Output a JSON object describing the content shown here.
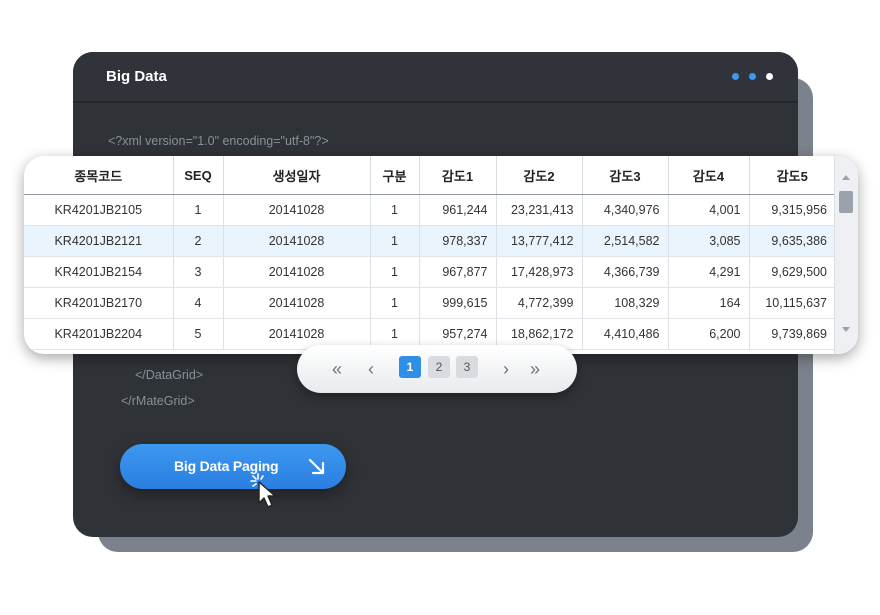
{
  "panel": {
    "title": "Big Data",
    "dot_colors": [
      "#3d98f0",
      "#3d98f0",
      "#ffffff"
    ]
  },
  "code": {
    "xml_decl": "<?xml version=\"1.0\" encoding=\"utf-8\"?>",
    "close_datagrid": "</DataGrid>",
    "close_rmategrid": "</rMateGrid>"
  },
  "cta": {
    "label": "Big Data Paging"
  },
  "grid": {
    "columns": [
      "종목코드",
      "SEQ",
      "생성일자",
      "구분",
      "감도1",
      "감도2",
      "감도3",
      "감도4",
      "감도5"
    ],
    "rows": [
      [
        "KR4201JB2105",
        "1",
        "20141028",
        "1",
        "961,244",
        "23,231,413",
        "4,340,976",
        "4,001",
        "9,315,956"
      ],
      [
        "KR4201JB2121",
        "2",
        "20141028",
        "1",
        "978,337",
        "13,777,412",
        "2,514,582",
        "3,085",
        "9,635,386"
      ],
      [
        "KR4201JB2154",
        "3",
        "20141028",
        "1",
        "967,877",
        "17,428,973",
        "4,366,739",
        "4,291",
        "9,629,500"
      ],
      [
        "KR4201JB2170",
        "4",
        "20141028",
        "1",
        "999,615",
        "4,772,399",
        "108,329",
        "164",
        "10,115,637"
      ],
      [
        "KR4201JB2204",
        "5",
        "20141028",
        "1",
        "957,274",
        "18,862,172",
        "4,410,486",
        "6,200",
        "9,739,869"
      ]
    ],
    "selected_row": 1
  },
  "pager": {
    "first": "«",
    "prev": "‹",
    "pages": [
      "1",
      "2",
      "3"
    ],
    "active_page": "1",
    "next": "›",
    "last": "»"
  }
}
